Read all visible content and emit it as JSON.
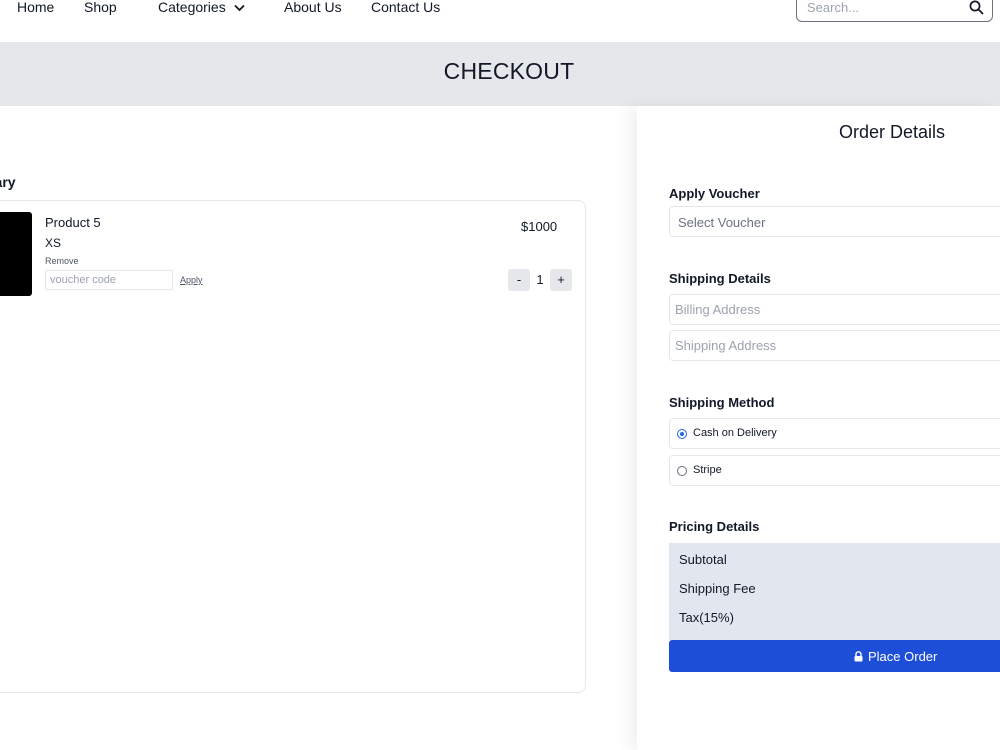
{
  "nav": {
    "links": [
      "Home",
      "Shop",
      "Categories",
      "About Us",
      "Contact Us"
    ],
    "search_placeholder": "Search..."
  },
  "banner": {
    "title": "CHECKOUT"
  },
  "summary": {
    "title_visible": "nary",
    "product": {
      "name": "Product 5",
      "size": "XS",
      "remove_label": "Remove",
      "voucher_placeholder": "voucher code",
      "apply_label": "Apply",
      "price": "$1000",
      "quantity": "1",
      "decrement_label": "-",
      "increment_label": "+"
    }
  },
  "order": {
    "title": "Order Details",
    "voucher": {
      "label": "Apply Voucher",
      "select_value": "Select Voucher"
    },
    "shipping_details": {
      "label": "Shipping Details",
      "billing_placeholder": "Billing Address",
      "shipping_placeholder": "Shipping Address"
    },
    "shipping_method": {
      "label": "Shipping Method",
      "options": [
        "Cash on Delivery",
        "Stripe"
      ],
      "selected": "Cash on Delivery"
    },
    "pricing": {
      "label": "Pricing Details",
      "rows": [
        "Subtotal",
        "Shipping Fee",
        "Tax(15%)"
      ]
    },
    "place_order_label": "Place Order"
  },
  "colors": {
    "accent": "#1d4ed8",
    "banner_bg": "#e5e7eb",
    "pricing_bg": "#e2e6ee"
  }
}
